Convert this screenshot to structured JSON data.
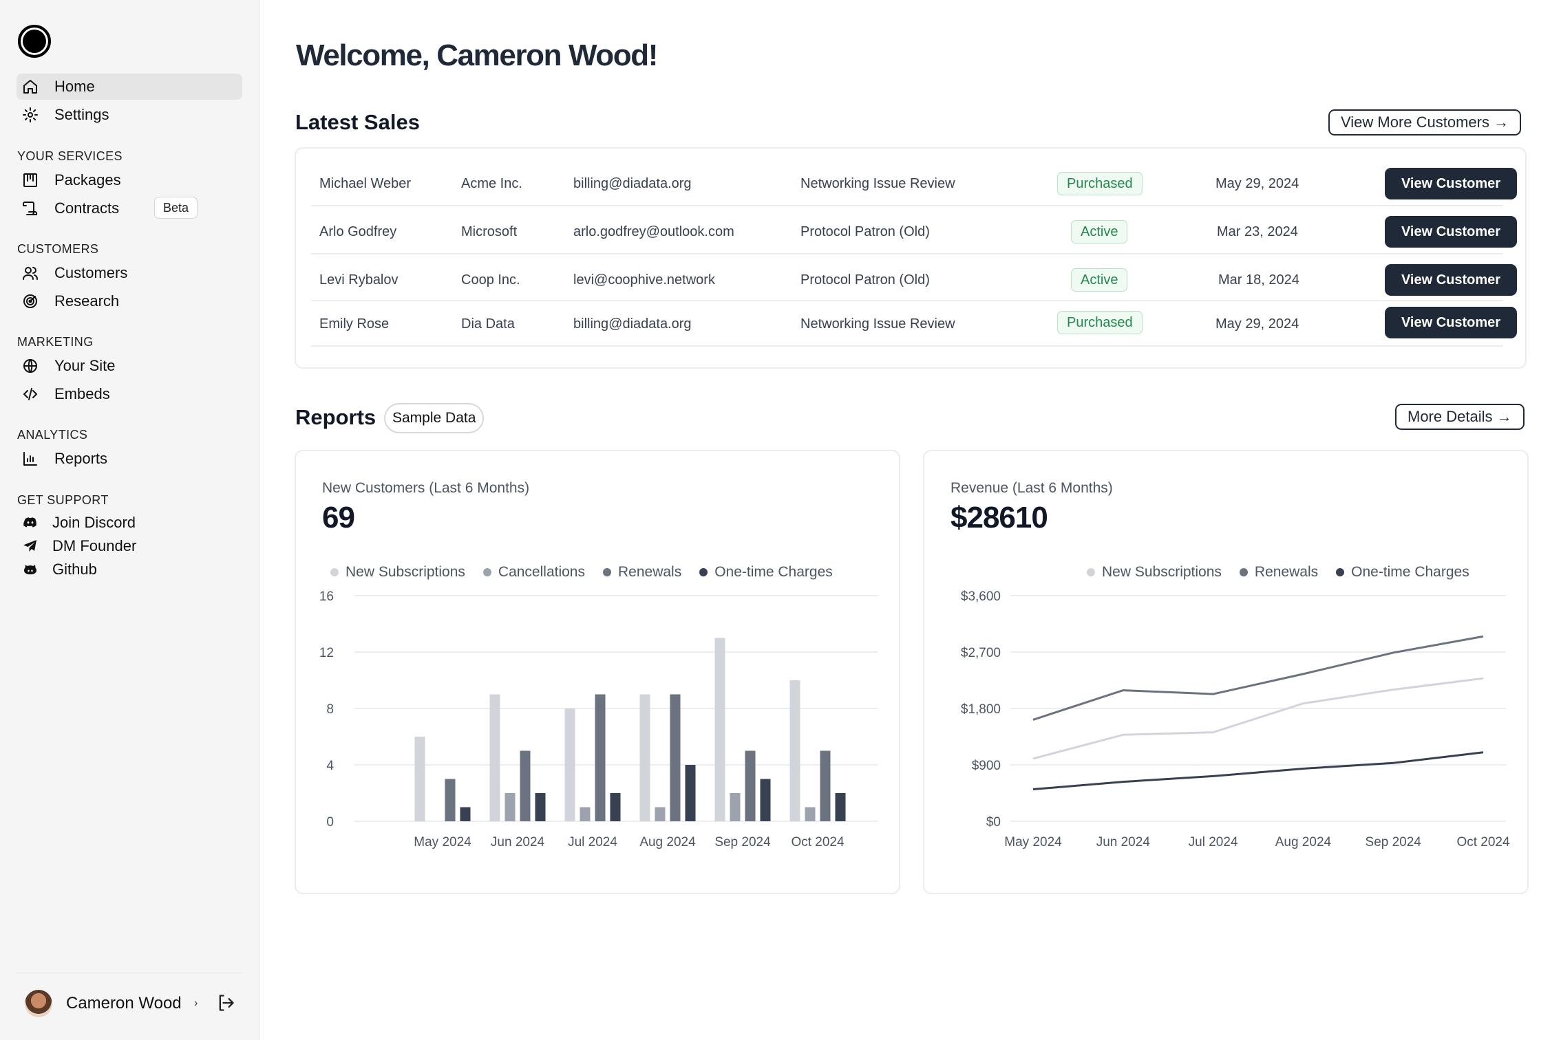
{
  "sidebar": {
    "nav": [
      {
        "label": "Home",
        "icon": "home-icon"
      },
      {
        "label": "Settings",
        "icon": "gear-icon"
      }
    ],
    "sections": [
      {
        "title": "YOUR SERVICES",
        "items": [
          {
            "label": "Packages",
            "icon": "package-icon"
          },
          {
            "label": "Contracts",
            "icon": "scroll-icon",
            "badge": "Beta"
          }
        ]
      },
      {
        "title": "CUSTOMERS",
        "items": [
          {
            "label": "Customers",
            "icon": "users-icon"
          },
          {
            "label": "Research",
            "icon": "radar-icon"
          }
        ]
      },
      {
        "title": "MARKETING",
        "items": [
          {
            "label": "Your Site",
            "icon": "globe-icon"
          },
          {
            "label": "Embeds",
            "icon": "code-icon"
          }
        ]
      },
      {
        "title": "ANALYTICS",
        "items": [
          {
            "label": "Reports",
            "icon": "bar-chart-icon"
          }
        ]
      },
      {
        "title": "GET SUPPORT",
        "items": [
          {
            "label": "Join Discord",
            "icon": "discord-icon"
          },
          {
            "label": "DM Founder",
            "icon": "send-icon"
          },
          {
            "label": "Github",
            "icon": "github-icon"
          }
        ]
      }
    ],
    "user": {
      "name": "Cameron Wood",
      "chevron": "›"
    }
  },
  "main": {
    "welcome": "Welcome, Cameron Wood!",
    "latest_sales": {
      "title": "Latest Sales",
      "view_more": "View More Customers →",
      "rows": [
        {
          "name": "Michael Weber",
          "company": "Acme Inc.",
          "email": "billing@diadata.org",
          "product": "Networking Issue Review",
          "status": "Purchased",
          "date": "May 29, 2024",
          "action": "View Customer"
        },
        {
          "name": "Arlo Godfrey",
          "company": "Microsoft",
          "email": "arlo.godfrey@outlook.com",
          "product": "Protocol Patron (Old)",
          "status": "Active",
          "date": "Mar 23, 2024",
          "action": "View Customer"
        },
        {
          "name": "Levi Rybalov",
          "company": "Coop Inc.",
          "email": "levi@coophive.network",
          "product": "Protocol Patron (Old)",
          "status": "Active",
          "date": "Mar 18, 2024",
          "action": "View Customer"
        },
        {
          "name": "Emily Rose",
          "company": "Dia Data",
          "email": "billing@diadata.org",
          "product": "Networking Issue Review",
          "status": "Purchased",
          "date": "May 29, 2024",
          "action": "View Customer"
        }
      ]
    },
    "reports": {
      "title": "Reports",
      "badge": "Sample Data",
      "more_details": "More Details →",
      "customers_card": {
        "label": "New Customers (Last 6 Months)",
        "value": "69"
      },
      "revenue_card": {
        "label": "Revenue (Last 6 Months)",
        "value": "$28610"
      }
    }
  },
  "colors": {
    "new_subscriptions": "#d1d5db",
    "cancellations": "#9ca3af",
    "renewals": "#6b7280",
    "one_time": "#374151",
    "status_green": "#25884d"
  },
  "chart_data": [
    {
      "type": "bar",
      "categories": [
        "May 2024",
        "Jun 2024",
        "Jul 2024",
        "Aug 2024",
        "Sep 2024",
        "Oct 2024"
      ],
      "series": [
        {
          "name": "New Subscriptions",
          "values": [
            6,
            9,
            8,
            9,
            13,
            10
          ]
        },
        {
          "name": "Cancellations",
          "values": [
            0,
            2,
            1,
            1,
            2,
            1
          ]
        },
        {
          "name": "Renewals",
          "values": [
            3,
            5,
            9,
            9,
            5,
            5
          ]
        },
        {
          "name": "One-time Charges",
          "values": [
            1,
            2,
            2,
            4,
            3,
            2
          ]
        }
      ],
      "ylim": [
        0,
        16
      ],
      "yticks": [
        "0",
        "4",
        "8",
        "12",
        "16"
      ],
      "grid": true,
      "legend_position": "top-right"
    },
    {
      "type": "line",
      "categories": [
        "May 2024",
        "Jun 2024",
        "Jul 2024",
        "Aug 2024",
        "Sep 2024",
        "Oct 2024"
      ],
      "series": [
        {
          "name": "New Subscriptions",
          "values": [
            1000,
            1380,
            1420,
            1880,
            2100,
            2280
          ]
        },
        {
          "name": "Renewals",
          "values": [
            1620,
            2090,
            2030,
            2350,
            2690,
            2950
          ]
        },
        {
          "name": "One-time Charges",
          "values": [
            510,
            630,
            720,
            840,
            930,
            1100
          ]
        }
      ],
      "ylim": [
        0,
        3600
      ],
      "yticks": [
        "$0",
        "$900",
        "$1,800",
        "$2,700",
        "$3,600"
      ],
      "grid": true,
      "legend_position": "top-right"
    }
  ]
}
